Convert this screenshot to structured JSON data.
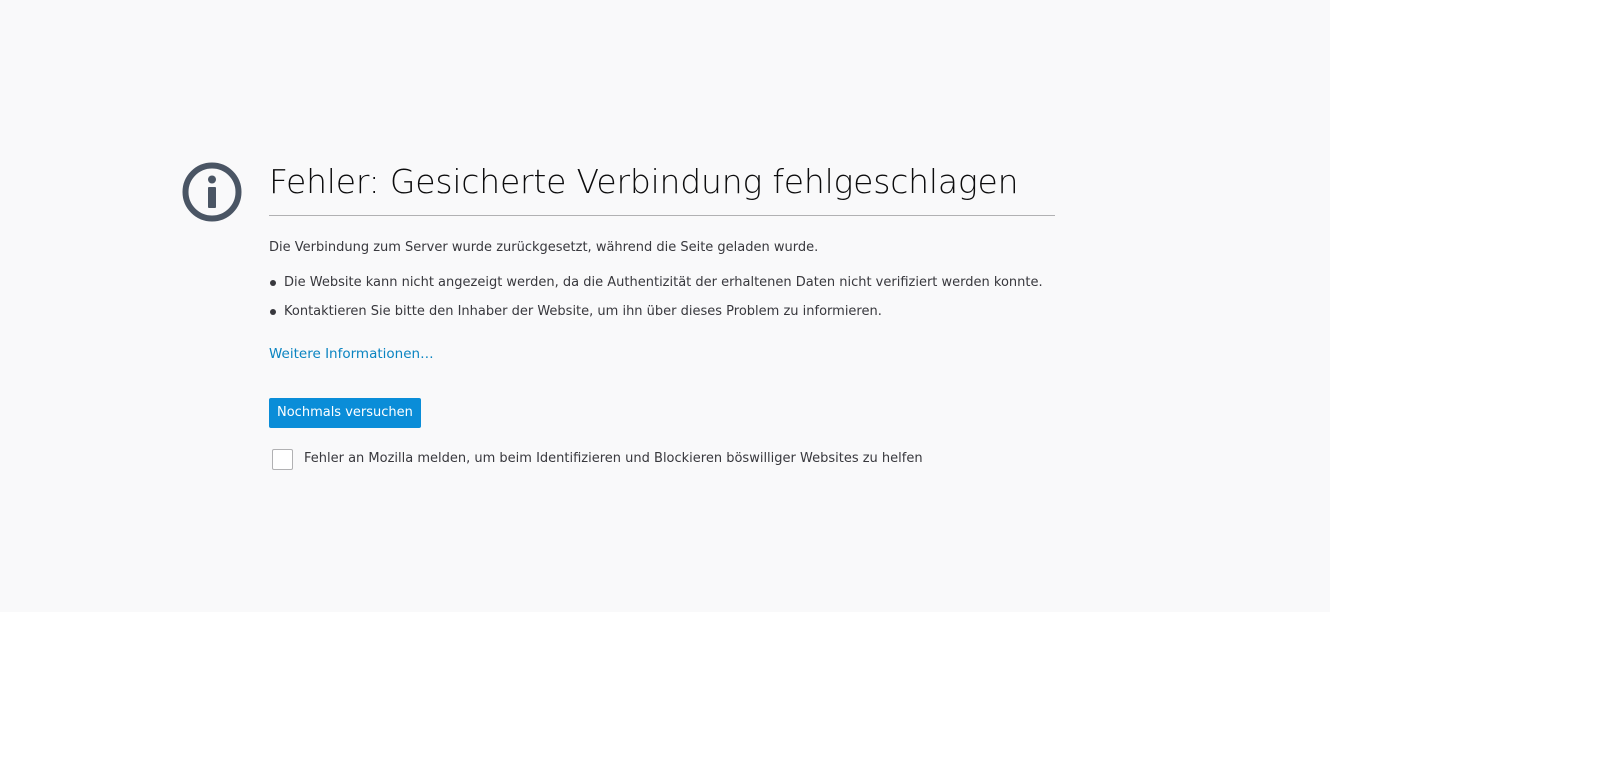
{
  "error_page": {
    "icon": "info-icon",
    "title": "Fehler: Gesicherte Verbindung fehlgeschlagen",
    "description": "Die Verbindung zum Server wurde zurückgesetzt, während die Seite geladen wurde.",
    "bullets": [
      "Die Website kann nicht angezeigt werden, da die Authentizität der erhaltenen Daten nicht verifiziert werden konnte.",
      "Kontaktieren Sie bitte den Inhaber der Website, um ihn über dieses Problem zu informieren."
    ],
    "learn_more_label": "Weitere Informationen…",
    "retry_label": "Nochmals versuchen",
    "report_checkbox": {
      "checked": false,
      "label": "Fehler an Mozilla melden, um beim Identifizieren und Blockieren böswilliger Websites zu helfen"
    }
  },
  "colors": {
    "page_background": "#f9f9fa",
    "icon": "#4a5564",
    "title_text": "#0c0c0d",
    "body_text": "#38383d",
    "link": "#0a84c1",
    "primary_button": "#0a8dd8",
    "divider": "#b1b1b3"
  }
}
